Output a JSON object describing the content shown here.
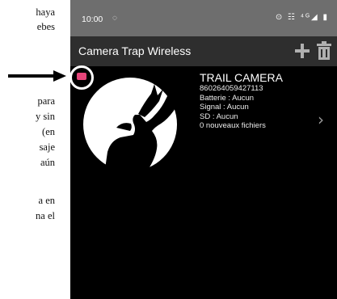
{
  "document": {
    "lines": [
      {
        "id": "l1",
        "text": "haya"
      },
      {
        "id": "l2",
        "text": "ebes"
      },
      {
        "id": "l3",
        "text": "para"
      },
      {
        "id": "l4",
        "text": "y  sin"
      },
      {
        "id": "l5",
        "text": "(en"
      },
      {
        "id": "l6",
        "text": "saje"
      },
      {
        "id": "l7",
        "text": "aún"
      },
      {
        "id": "l8",
        "text": "a en"
      },
      {
        "id": "l9",
        "text": "na el"
      }
    ]
  },
  "status_bar": {
    "time": "10:00",
    "notification_icon": "signal-dot-icon",
    "right_icons": "⊙ ☷ ⁴ᴳ◢ ▮"
  },
  "app_bar": {
    "title": "Camera Trap Wireless",
    "add_icon": "plus-icon",
    "delete_icon": "trash-icon"
  },
  "camera": {
    "name": "TRAIL CAMERA",
    "id": "860264059427113",
    "battery": "Batterie : Aucun",
    "signal": "Signal : Aucun",
    "sd": "SD : Aucun",
    "new_files": "0 nouveaux fichiers",
    "badge_color": "#e6457a",
    "logo": "deer-head-logo"
  },
  "colors": {
    "status_bar": "#6e6e6e",
    "app_bar": "#2e2e2e",
    "background": "#000000",
    "annotation": "#ffffff"
  }
}
